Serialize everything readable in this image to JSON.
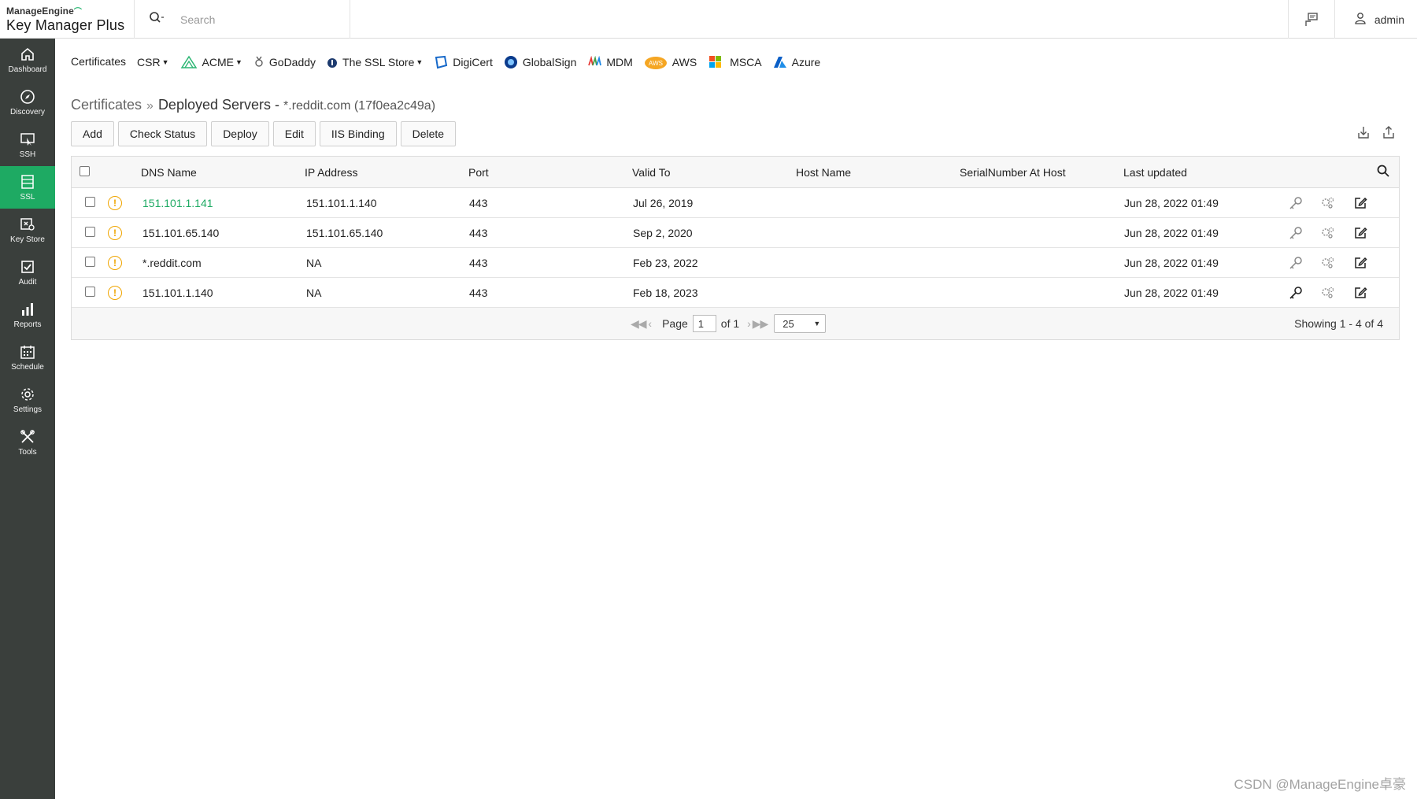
{
  "app": {
    "brand": "ManageEngine",
    "product": "Key Manager Plus",
    "accent_color": "#1eaa63",
    "sidebar_bg": "#3a3f3c"
  },
  "header": {
    "search_placeholder": "Search",
    "user_name": "admin"
  },
  "sidebar": {
    "items": [
      {
        "label": "Dashboard",
        "icon": "home-icon"
      },
      {
        "label": "Discovery",
        "icon": "compass-icon"
      },
      {
        "label": "SSH",
        "icon": "ssh-icon"
      },
      {
        "label": "SSL",
        "icon": "ssl-icon",
        "active": true
      },
      {
        "label": "Key Store",
        "icon": "keystore-icon"
      },
      {
        "label": "Audit",
        "icon": "audit-icon"
      },
      {
        "label": "Reports",
        "icon": "reports-icon"
      },
      {
        "label": "Schedule",
        "icon": "calendar-icon"
      },
      {
        "label": "Settings",
        "icon": "gear-icon"
      },
      {
        "label": "Tools",
        "icon": "tools-icon"
      }
    ]
  },
  "vendor_nav": {
    "certificates": "Certificates",
    "csr": "CSR",
    "acme": "ACME",
    "godaddy": "GoDaddy",
    "sslstore": "The SSL Store",
    "digicert": "DigiCert",
    "globalsign": "GlobalSign",
    "mdm": "MDM",
    "aws": "AWS",
    "msca": "MSCA",
    "azure": "Azure"
  },
  "breadcrumb": {
    "root": "Certificates",
    "separator": "»",
    "current": "Deployed Servers -",
    "sub": "*.reddit.com (17f0ea2c49a)"
  },
  "toolbar": {
    "add": "Add",
    "check_status": "Check Status",
    "deploy": "Deploy",
    "edit": "Edit",
    "iis_binding": "IIS Binding",
    "delete": "Delete"
  },
  "table": {
    "headers": {
      "dns": "DNS Name",
      "ip": "IP Address",
      "port": "Port",
      "valid": "Valid To",
      "host": "Host Name",
      "serial": "SerialNumber At Host",
      "updated": "Last updated"
    },
    "rows": [
      {
        "dns": "151.101.1.141",
        "ip": "151.101.1.140",
        "port": "443",
        "valid": "Jul 26, 2019",
        "host": "",
        "serial": "",
        "updated": "Jun 28, 2022 01:49"
      },
      {
        "dns": "151.101.65.140",
        "ip": "151.101.65.140",
        "port": "443",
        "valid": "Sep 2, 2020",
        "host": "",
        "serial": "",
        "updated": "Jun 28, 2022 01:49"
      },
      {
        "dns": "*.reddit.com",
        "ip": "NA",
        "port": "443",
        "valid": "Feb 23, 2022",
        "host": "",
        "serial": "",
        "updated": "Jun 28, 2022 01:49"
      },
      {
        "dns": "151.101.1.140",
        "ip": "NA",
        "port": "443",
        "valid": "Feb 18, 2023",
        "host": "",
        "serial": "",
        "updated": "Jun 28, 2022 01:49"
      }
    ]
  },
  "pager": {
    "page_label": "Page",
    "page_value": "1",
    "of_label": "of 1",
    "page_size": "25",
    "showing": "Showing 1 - 4 of 4"
  },
  "watermark": "CSDN @ManageEngine卓豪"
}
